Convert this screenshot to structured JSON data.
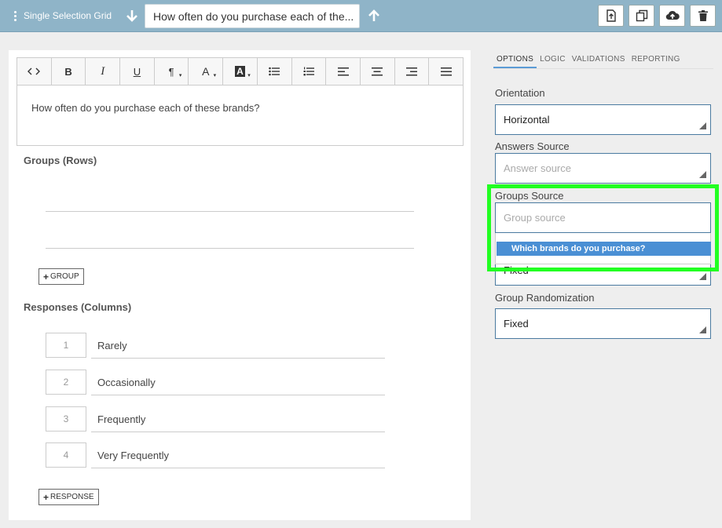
{
  "topbar": {
    "question_type": "Single Selection Grid",
    "question_title": "How often do you purchase each of the...",
    "actions": [
      {
        "name": "export-icon"
      },
      {
        "name": "copy-icon"
      },
      {
        "name": "cloud-upload-icon"
      },
      {
        "name": "trash-icon"
      }
    ]
  },
  "editor": {
    "toolbar": [
      {
        "name": "code-view-button",
        "glyph": "<>"
      },
      {
        "name": "bold-button",
        "glyph": "B"
      },
      {
        "name": "italic-button",
        "glyph": "I"
      },
      {
        "name": "underline-button",
        "glyph": "U"
      },
      {
        "name": "paragraph-button",
        "glyph": "¶"
      },
      {
        "name": "text-color-button",
        "glyph": "A"
      },
      {
        "name": "background-color-button",
        "glyph": "A"
      },
      {
        "name": "bullet-list-button",
        "glyph": "bullets"
      },
      {
        "name": "numbered-list-button",
        "glyph": "numbers"
      },
      {
        "name": "align-left-button",
        "glyph": "left"
      },
      {
        "name": "align-center-button",
        "glyph": "center"
      },
      {
        "name": "align-right-button",
        "glyph": "right"
      },
      {
        "name": "justify-button",
        "glyph": "justify"
      }
    ],
    "question_text": "How often do you purchase each of these brands?"
  },
  "groups": {
    "label": "Groups (Rows)",
    "add_label": "GROUP"
  },
  "responses": {
    "label": "Responses (Columns)",
    "items": [
      {
        "num": "1",
        "text": "Rarely"
      },
      {
        "num": "2",
        "text": "Occasionally"
      },
      {
        "num": "3",
        "text": "Frequently"
      },
      {
        "num": "4",
        "text": "Very Frequently"
      }
    ],
    "add_label": "RESPONSE"
  },
  "panel": {
    "tabs": [
      "OPTIONS",
      "LOGIC",
      "VALIDATIONS",
      "REPORTING"
    ],
    "active_tab": "OPTIONS",
    "orientation": {
      "label": "Orientation",
      "value": "Horizontal"
    },
    "answers_source": {
      "label": "Answers Source",
      "placeholder": "Answer source"
    },
    "groups_source": {
      "label": "Groups Source",
      "placeholder": "Group source"
    },
    "dropdown_option": "Which brands do you purchase?",
    "hidden_select_value": "Fixed",
    "group_randomization": {
      "label": "Group Randomization",
      "value": "Fixed"
    }
  },
  "colors": {
    "topbar": "#8fb4c8",
    "highlight": "#22ff22",
    "option_selected": "#4a8fd4"
  }
}
